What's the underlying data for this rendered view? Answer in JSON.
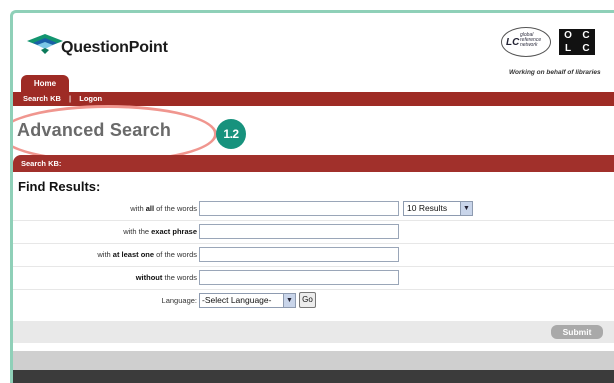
{
  "logo": {
    "text": "QuestionPoint",
    "icon": "questionpoint-diamond-logo"
  },
  "partners": {
    "lc_logo": {
      "mark": "LC",
      "sub": "global reference network",
      "icon": "lc-global-reference-network-logo"
    },
    "oclc_logo": {
      "letters": [
        "O",
        "C",
        "L",
        "C"
      ],
      "icon": "oclc-logo"
    },
    "tagline": "Working on behalf of libraries"
  },
  "nav": {
    "tab_home": "Home",
    "links": [
      "Search KB",
      "Logon"
    ],
    "separator": "|"
  },
  "page": {
    "title": "Advanced Search",
    "step_badge": "1.2",
    "search_bar_label": "Search KB:",
    "find_results": "Find Results:"
  },
  "form": {
    "rows": [
      {
        "pre": "with ",
        "bold": "all",
        "post": " of the words"
      },
      {
        "pre": "with the ",
        "bold": "exact phrase",
        "post": ""
      },
      {
        "pre": "with ",
        "bold": "at least one",
        "post": " of the words"
      },
      {
        "pre": "",
        "bold": "without",
        "post": " the words"
      }
    ],
    "results_select": "10 Results",
    "language_label": "Language:",
    "language_select": "-Select Language-",
    "go_button": "Go",
    "submit_button": "Submit"
  },
  "colors": {
    "brand_red": "#9e2b25",
    "badge_teal": "#17927d",
    "highlight_ellipse": "#f0968f",
    "frame_border": "#8fd0b8"
  }
}
